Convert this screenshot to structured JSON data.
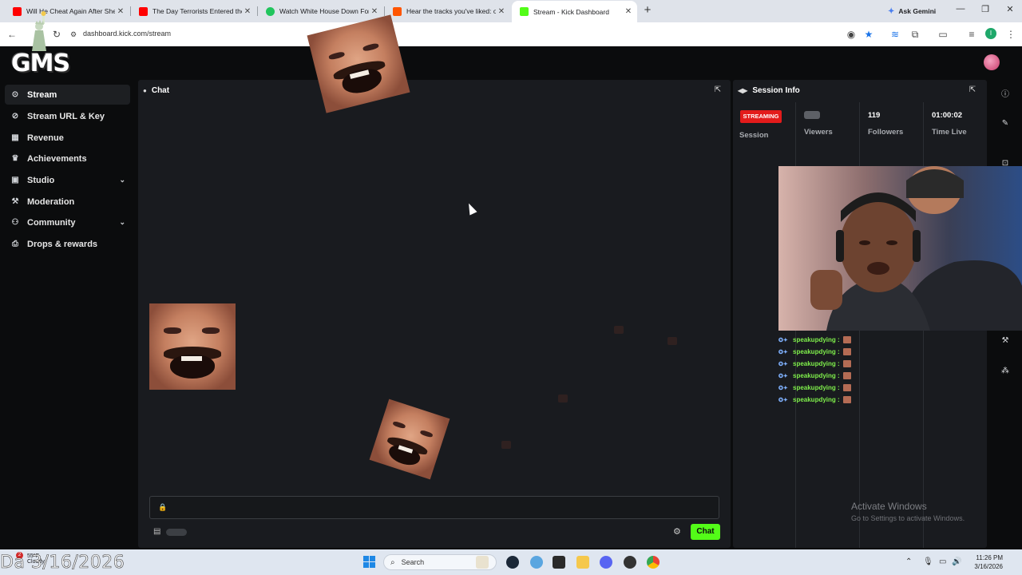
{
  "browser": {
    "tabs": [
      {
        "label": "Will He Cheat Again After She",
        "favicon_color": "#ff0000",
        "active": false
      },
      {
        "label": "The Day Terrorists Entered the",
        "favicon_color": "#ff0000",
        "active": false
      },
      {
        "label": "Watch White House Down For",
        "favicon_color": "#21c55d",
        "active": false
      },
      {
        "label": "Hear the tracks you've liked: on",
        "favicon_color": "#ff5500",
        "active": false
      },
      {
        "label": "Stream - Kick Dashboard",
        "favicon_color": "#53fc18",
        "active": true
      }
    ],
    "ask_gemini": "Ask Gemini",
    "url": "dashboard.kick.com/stream",
    "profile_initial": "I"
  },
  "app": {
    "logo_text": "GMS",
    "sidebar": [
      {
        "label": "Stream",
        "icon": "broadcast-icon",
        "glyph": "((·))",
        "active": true,
        "expandable": false
      },
      {
        "label": "Stream URL & Key",
        "icon": "link-icon",
        "glyph": "🔗",
        "active": false,
        "expandable": false
      },
      {
        "label": "Revenue",
        "icon": "revenue-icon",
        "glyph": "▦",
        "active": false,
        "expandable": false
      },
      {
        "label": "Achievements",
        "icon": "trophy-icon",
        "glyph": "🏆",
        "active": false,
        "expandable": false
      },
      {
        "label": "Studio",
        "icon": "studio-icon",
        "glyph": "▣",
        "active": false,
        "expandable": true
      },
      {
        "label": "Moderation",
        "icon": "wrench-icon",
        "glyph": "🔧",
        "active": false,
        "expandable": false
      },
      {
        "label": "Community",
        "icon": "community-icon",
        "glyph": "👥",
        "active": false,
        "expandable": true
      },
      {
        "label": "Drops & rewards",
        "icon": "drops-icon",
        "glyph": "⎗",
        "active": false,
        "expandable": false
      }
    ],
    "chat_panel": {
      "title": "Chat",
      "send_label": "Chat",
      "accent": "#53fc18"
    },
    "session_panel": {
      "title": "Session Info",
      "status_badge": "STREAMING",
      "status_color": "#e31b1b",
      "stats": [
        {
          "label": "Session",
          "value": ""
        },
        {
          "label": "Viewers",
          "value": ""
        },
        {
          "label": "Followers",
          "value": "119"
        },
        {
          "label": "Time Live",
          "value": "01:00:02"
        }
      ],
      "chat_log": [
        {
          "user": "speakupdying :"
        },
        {
          "user": "speakupdying :"
        },
        {
          "user": "speakupdying :"
        },
        {
          "user": "speakupdying :"
        },
        {
          "user": "speakupdying :"
        },
        {
          "user": "speakupdying :"
        }
      ]
    },
    "activate_windows": {
      "title": "Activate Windows",
      "subtitle": "Go to Settings to activate Windows."
    }
  },
  "taskbar": {
    "overlay_date": "Da 3/16/2026",
    "weather_temp": "55°F",
    "weather_badge": "2",
    "weather_desc": "Cloudy",
    "search_placeholder": "Search",
    "clock_time": "11:26 PM",
    "clock_date": "3/16/2026"
  }
}
